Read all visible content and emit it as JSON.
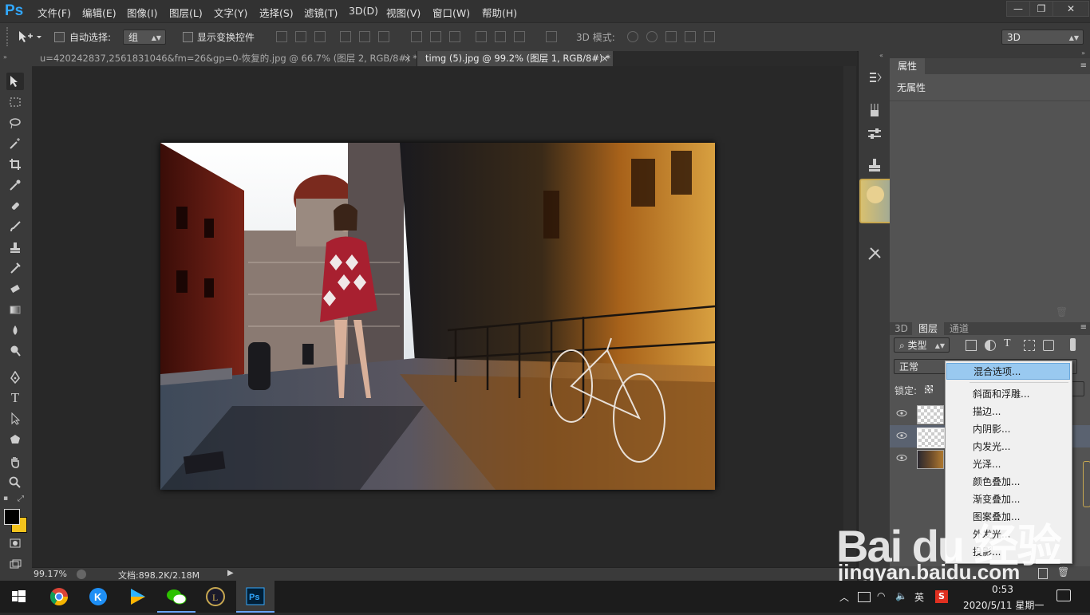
{
  "app": {
    "logo": "Ps"
  },
  "menu": [
    "文件(F)",
    "编辑(E)",
    "图像(I)",
    "图层(L)",
    "文字(Y)",
    "选择(S)",
    "滤镜(T)",
    "3D(D)",
    "视图(V)",
    "窗口(W)",
    "帮助(H)"
  ],
  "window_controls": {
    "minimize": "—",
    "restore": "❐",
    "close": "✕"
  },
  "options": {
    "auto_select_label": "自动选择:",
    "auto_select_value": "组",
    "show_transform_label": "显示变换控件",
    "mode_3d_label": "3D 模式:",
    "workspace_value": "3D"
  },
  "tabs": [
    {
      "title": "u=420242837,2561831046&fm=26&gp=0-恢复的.jpg @ 66.7% (图层 2, RGB/8#) *",
      "close": "×"
    },
    {
      "title": "timg (5).jpg @ 99.2% (图层 1, RGB/8#) *",
      "close": "×"
    }
  ],
  "status": {
    "zoom": "99.17%",
    "doc_info": "文档:898.2K/2.18M"
  },
  "properties": {
    "tab": "属性",
    "content": "无属性"
  },
  "layers_panel": {
    "tabs": [
      "3D",
      "图层",
      "通道"
    ],
    "filter_label": "类型",
    "blend_mode": "正常",
    "lock_label": "锁定:"
  },
  "context_menu": {
    "items": [
      "混合选项...",
      "斜面和浮雕...",
      "描边...",
      "内阴影...",
      "内发光...",
      "光泽...",
      "颜色叠加...",
      "渐变叠加...",
      "图案叠加...",
      "外发光...",
      "投影..."
    ],
    "highlighted_index": 0
  },
  "taskbar": {
    "tray_lang": "英",
    "time": "0:53",
    "date": "2020/5/11 星期一"
  },
  "watermark": {
    "logo": "Bai du 经验",
    "site": "jingyan.baidu.com"
  },
  "colors": {
    "menu_bg": "#323232",
    "panel_bg": "#535353",
    "accent": "#31a8ff",
    "highlight": "#99c9f0"
  }
}
